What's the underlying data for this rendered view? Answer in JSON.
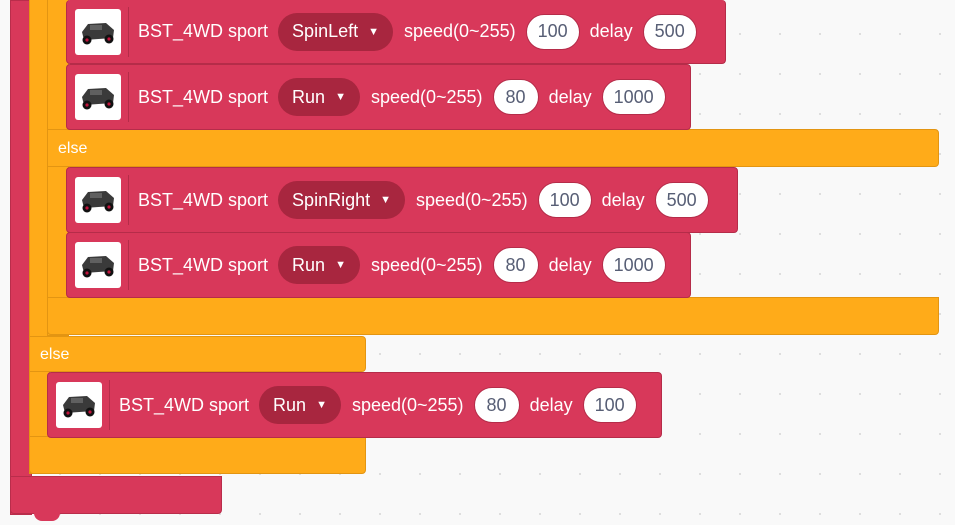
{
  "blocks": [
    {
      "prefix": "BST_4WD sport",
      "mode": "SpinLeft",
      "speed_label": "speed(0~255)",
      "speed": "100",
      "delay_label": "delay",
      "delay": "500",
      "robot_icon": "robot-car-icon"
    },
    {
      "prefix": "BST_4WD sport",
      "mode": "Run",
      "speed_label": "speed(0~255)",
      "speed": "80",
      "delay_label": "delay",
      "delay": "1000",
      "robot_icon": "robot-car-icon"
    },
    {
      "prefix": "BST_4WD sport",
      "mode": "SpinRight",
      "speed_label": "speed(0~255)",
      "speed": "100",
      "delay_label": "delay",
      "delay": "500",
      "robot_icon": "robot-car-icon"
    },
    {
      "prefix": "BST_4WD sport",
      "mode": "Run",
      "speed_label": "speed(0~255)",
      "speed": "80",
      "delay_label": "delay",
      "delay": "1000",
      "robot_icon": "robot-car-icon"
    },
    {
      "prefix": "BST_4WD sport",
      "mode": "Run",
      "speed_label": "speed(0~255)",
      "speed": "80",
      "delay_label": "delay",
      "delay": "100",
      "robot_icon": "robot-car-icon"
    }
  ],
  "else_labels": [
    "else",
    "else"
  ],
  "colors": {
    "motion_block": "#d8385a",
    "control_block": "#ffab19",
    "dropdown": "#a8263f"
  }
}
